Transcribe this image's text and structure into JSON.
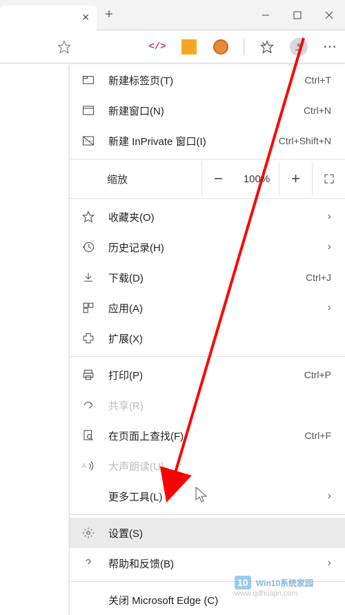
{
  "window": {
    "minimize": "—",
    "maximize": "▢",
    "close": "✕"
  },
  "toolbar": {
    "star": "☆",
    "dev": "</>",
    "favstar": "⋆",
    "more": "⋯"
  },
  "menu": {
    "new_tab": {
      "label": "新建标签页(T)",
      "shortcut": "Ctrl+T"
    },
    "new_window": {
      "label": "新建窗口(N)",
      "shortcut": "Ctrl+N"
    },
    "new_inprivate": {
      "label": "新建 InPrivate 窗口(I)",
      "shortcut": "Ctrl+Shift+N"
    },
    "zoom": {
      "label": "缩放",
      "value": "100%"
    },
    "favorites": {
      "label": "收藏夹(O)"
    },
    "history": {
      "label": "历史记录(H)"
    },
    "downloads": {
      "label": "下载(D)",
      "shortcut": "Ctrl+J"
    },
    "apps": {
      "label": "应用(A)"
    },
    "extensions": {
      "label": "扩展(X)"
    },
    "print": {
      "label": "打印(P)",
      "shortcut": "Ctrl+P"
    },
    "share": {
      "label": "共享(R)"
    },
    "find": {
      "label": "在页面上查找(F)",
      "shortcut": "Ctrl+F"
    },
    "read_aloud": {
      "label": "大声朗读(U)"
    },
    "more_tools": {
      "label": "更多工具(L)"
    },
    "settings": {
      "label": "设置(S)"
    },
    "help": {
      "label": "帮助和反馈(B)"
    },
    "close_edge": {
      "label": "关闭 Microsoft Edge (C)"
    }
  },
  "watermark": {
    "badge": "10",
    "title": "Win10系统家园",
    "url": "www.qdhuajin.com"
  }
}
